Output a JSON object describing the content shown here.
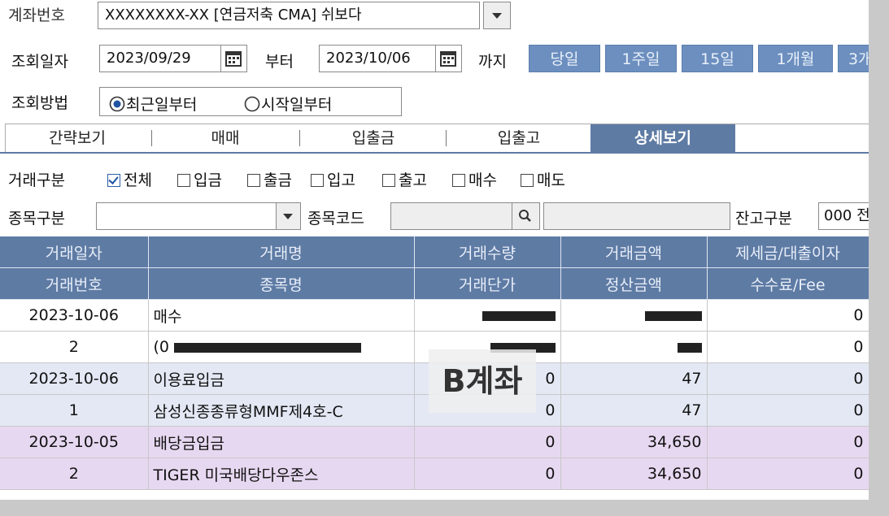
{
  "account": {
    "label": "계좌번호",
    "value": "XXXXXXXX-XX [연금저축 CMA] 쉬보다"
  },
  "query_date": {
    "label": "조회일자",
    "from": "2023/09/29",
    "from_suffix": "부터",
    "to": "2023/10/06",
    "to_suffix": "까지"
  },
  "period_buttons": [
    "당일",
    "1주일",
    "15일",
    "1개월",
    "3개"
  ],
  "query_method": {
    "label": "조회방법",
    "options": [
      "최근일부터",
      "시작일부터"
    ],
    "selected": "최근일부터"
  },
  "tabs": [
    "간략보기",
    "매매",
    "입출금",
    "입출고",
    "상세보기"
  ],
  "active_tab": "상세보기",
  "trade_type": {
    "label": "거래구분",
    "options": [
      {
        "label": "전체",
        "checked": true
      },
      {
        "label": "입금",
        "checked": false
      },
      {
        "label": "출금",
        "checked": false
      },
      {
        "label": "입고",
        "checked": false
      },
      {
        "label": "출고",
        "checked": false
      },
      {
        "label": "매수",
        "checked": false
      },
      {
        "label": "매도",
        "checked": false
      }
    ]
  },
  "item_filter": {
    "type_label": "종목구분",
    "code_label": "종목코드",
    "balance_label": "잔고구분",
    "balance_value": "000 전"
  },
  "table": {
    "header_row1": [
      "거래일자",
      "거래명",
      "거래수량",
      "거래금액",
      "제세금/대출이자"
    ],
    "header_row2": [
      "거래번호",
      "종목명",
      "거래단가",
      "정산금액",
      "수수료/Fee"
    ],
    "rows": [
      {
        "style": "w",
        "cells": [
          "2023-10-06",
          "매수",
          "",
          "",
          "0"
        ]
      },
      {
        "style": "w",
        "cells": [
          "2",
          "(0",
          "",
          "",
          "0"
        ]
      },
      {
        "style": "b",
        "cells": [
          "2023-10-06",
          "이용료입금",
          "0",
          "47",
          "0"
        ]
      },
      {
        "style": "b",
        "cells": [
          "1",
          "삼성신종종류형MMF제4호-C",
          "0",
          "47",
          "0"
        ]
      },
      {
        "style": "p",
        "cells": [
          "2023-10-05",
          "배당금입금",
          "0",
          "34,650",
          "0"
        ]
      },
      {
        "style": "p",
        "cells": [
          "2",
          "TIGER 미국배당다우존스",
          "0",
          "34,650",
          "0"
        ]
      }
    ]
  },
  "overlay_text": "B계좌",
  "colors": {
    "header_bg": "#5e7ba4",
    "button_bg": "#6c8fbf",
    "row_blue": "#e3e8f4",
    "row_purple": "#e7d8f1"
  }
}
